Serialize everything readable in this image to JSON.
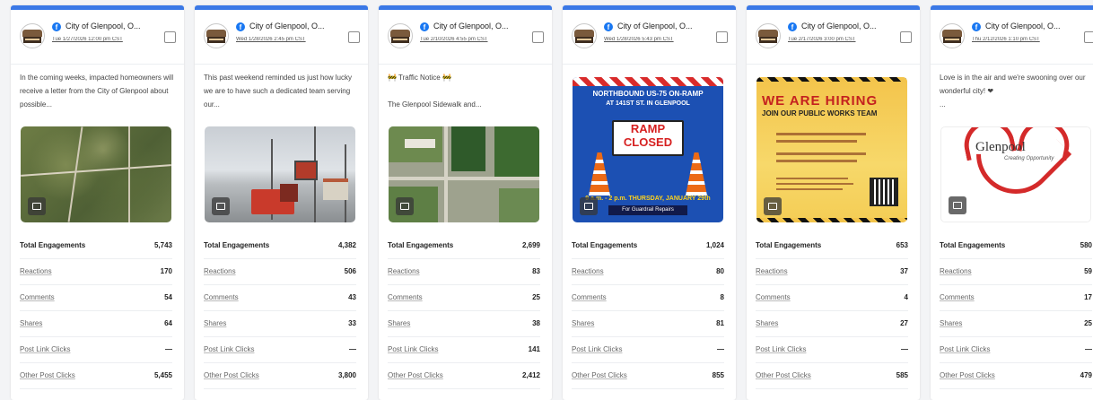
{
  "page_name": "City of Glenpool, O...",
  "colors": {
    "accent": "#3a78e6",
    "facebook": "#1877f2"
  },
  "metric_labels": {
    "total": "Total Engagements",
    "reactions": "Reactions",
    "comments": "Comments",
    "shares": "Shares",
    "link_clicks": "Post Link Clicks",
    "other_clicks": "Other Post Clicks"
  },
  "posts": [
    {
      "date": "Tue 1/27/2026 12:00 pm CST",
      "message": "In the coming weeks, impacted homeowners will receive a letter from the City of Glenpool about possible...",
      "image": "aerial-map",
      "total": "5,743",
      "reactions": "170",
      "comments": "54",
      "shares": "64",
      "link_clicks": "—",
      "other_clicks": "5,455"
    },
    {
      "date": "Wed 1/28/2026 2:45 pm CST",
      "message": "This past weekend reminded us just how lucky we are to have such a dedicated team serving our...",
      "image": "snowy-street",
      "total": "4,382",
      "reactions": "506",
      "comments": "43",
      "shares": "33",
      "link_clicks": "—",
      "other_clicks": "3,800"
    },
    {
      "date": "Tue 2/10/2026 4:55 pm CST",
      "message": "🚧 Traffic Notice 🚧\n\nThe Glenpool Sidewalk and...",
      "image": "aerial-streets",
      "total": "2,699",
      "reactions": "83",
      "comments": "25",
      "shares": "38",
      "link_clicks": "141",
      "other_clicks": "2,412"
    },
    {
      "date": "Wed 1/28/2026 5:43 pm CST",
      "message": "",
      "image": "ramp-closed",
      "image_text": {
        "line1": "NORTHBOUND US-75 ON-RAMP",
        "line2": "AT 141ST ST. IN GLENPOOL",
        "sign1": "RAMP",
        "sign2": "CLOSED",
        "line3": "9 a.m. - 2 p.m. THURSDAY, JANUARY 29th",
        "line4": "For Guardrail Repairs"
      },
      "total": "1,024",
      "reactions": "80",
      "comments": "8",
      "shares": "81",
      "link_clicks": "—",
      "other_clicks": "855"
    },
    {
      "date": "Tue 2/17/2026 3:00 pm CST",
      "message": "",
      "image": "we-are-hiring",
      "image_text": {
        "headline": "WE ARE HIRING",
        "subline": "JOIN OUR PUBLIC WORKS TEAM"
      },
      "total": "653",
      "reactions": "37",
      "comments": "4",
      "shares": "27",
      "link_clicks": "—",
      "other_clicks": "585"
    },
    {
      "date": "Thu 2/12/2026 1:10 pm CST",
      "message": "Love is in the air and we're swooning over our wonderful city! ❤\n...",
      "image": "heart-logo",
      "image_text": {
        "logo": "Glenpool",
        "slogan": "Creating Opportunity"
      },
      "total": "580",
      "reactions": "59",
      "comments": "17",
      "shares": "25",
      "link_clicks": "—",
      "other_clicks": "479"
    }
  ]
}
